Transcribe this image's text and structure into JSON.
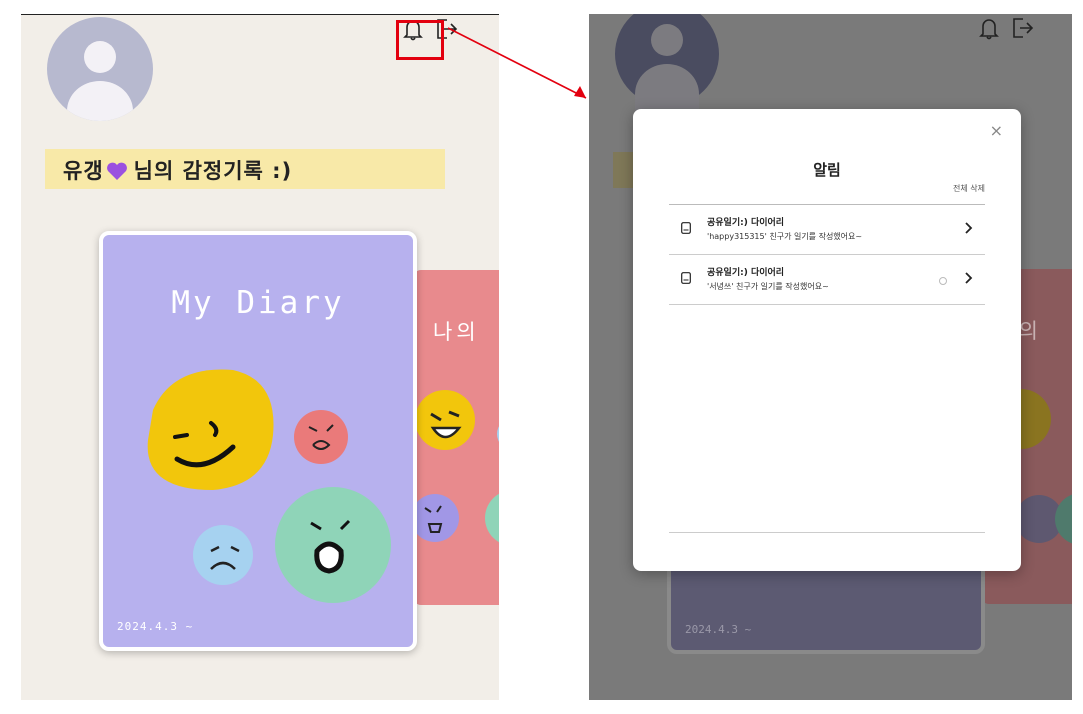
{
  "left_screen": {
    "greeting_name": "유갱",
    "greeting_suffix": "님의 감정기록 :)",
    "diary_card": {
      "title": "My Diary",
      "date": "2024.4.3 ~"
    },
    "second_card": {
      "title": "나의"
    }
  },
  "right_screen": {
    "notification_modal": {
      "title": "알림",
      "delete_all": "전체 삭제",
      "close": "×",
      "items": [
        {
          "title": "공유일기:) 다이어리",
          "body": "'happy315315' 친구가 일기를 작성했어요~"
        },
        {
          "title": "공유일기:) 다이어리",
          "body": "'서녕쓰' 친구가 일기를 작성했어요~"
        }
      ]
    },
    "background_date": "2024.4.3 ~",
    "background_card_text": "-의"
  },
  "colors": {
    "highlight": "#e3000f",
    "arrow": "#e3000f",
    "diary_card": "#b7b1ee",
    "second_card": "#e88a8d",
    "greeting_strip": "#f8e9a8",
    "heart": "#9b51e0"
  },
  "icons": [
    "bell-icon",
    "logout-icon",
    "document-icon",
    "chevron-right-icon",
    "close-icon",
    "heart-icon"
  ]
}
